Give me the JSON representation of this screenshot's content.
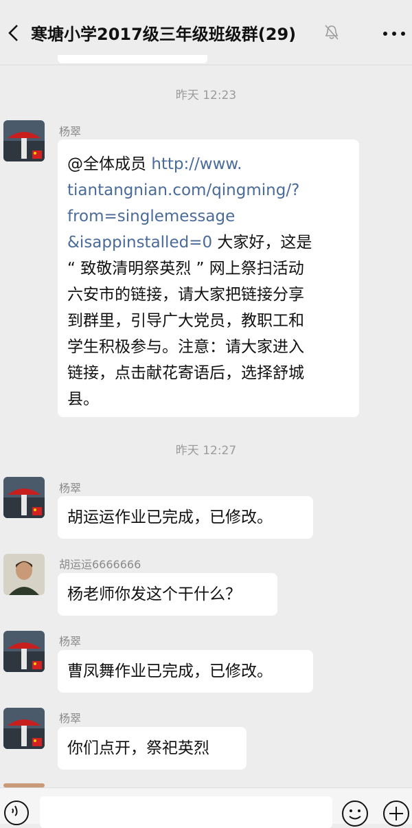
{
  "header": {
    "title": "寒塘小学2017级三年级班级群(29)",
    "icons": {
      "back": "chevron-left-icon",
      "mute": "bell-muted-icon",
      "more": "more-dots-icon"
    }
  },
  "messages": {
    "time1": "昨天 12:23",
    "m1": {
      "sender": "杨翠",
      "line1_prefix": "@全体成员 ",
      "line1_link": "http://www.",
      "line2_link": "tiantangnian.com/qingming/?",
      "line3_link": "from=singlemessage",
      "line4_link": "&isappinstalled=0",
      "line4_text": " 大家好，这是",
      "line5": "“ 致敬清明祭英烈 ” 网上祭扫活动",
      "line6": "六安市的链接，请大家把链接分享",
      "line7": "到群里，引导广大党员，教职工和",
      "line8": "学生积极参与。注意：请大家进入",
      "line9": "链接，点击献花寄语后，选择舒城",
      "line10": "县。"
    },
    "time2": "昨天 12:27",
    "m2": {
      "sender": "杨翠",
      "text": "胡运运作业已完成，已修改。"
    },
    "m3": {
      "sender": "胡运运6666666",
      "text": "杨老师你发这个干什么？"
    },
    "m4": {
      "sender": "杨翠",
      "text": "曹凤舞作业已完成，已修改。"
    },
    "m5": {
      "sender": "杨翠",
      "text": "你们点开，祭祀英烈"
    }
  },
  "inputbar": {
    "value": "",
    "icons": {
      "voice": "voice-icon",
      "emoji": "emoji-icon",
      "plus": "plus-icon"
    }
  }
}
